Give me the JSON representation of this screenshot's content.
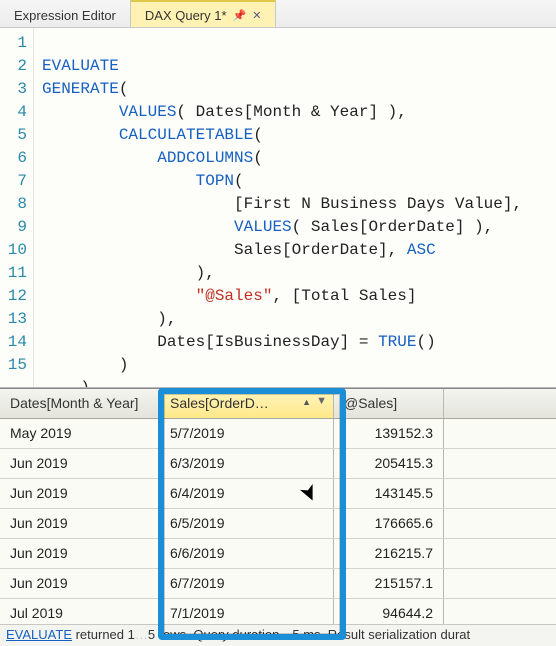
{
  "tabs": {
    "expression": "Expression Editor",
    "query": "DAX Query 1*"
  },
  "code": {
    "lines": 15,
    "l1_kw": "EVALUATE",
    "l2_fn": "GENERATE",
    "l2_r": "(",
    "l3_fn": "VALUES",
    "l3_r": "( Dates[Month & Year] ),",
    "l4_fn": "CALCULATETABLE",
    "l4_r": "(",
    "l5_fn": "ADDCOLUMNS",
    "l5_r": "(",
    "l6_fn": "TOPN",
    "l6_r": "(",
    "l7": "[First N Business Days Value],",
    "l8_fn": "VALUES",
    "l8_r": "( Sales[OrderDate] ),",
    "l9_a": "Sales[OrderDate], ",
    "l9_kw": "ASC",
    "l10": "),",
    "l11_str": "\"@Sales\"",
    "l11_r": ", [Total Sales]",
    "l12": "),",
    "l13_a": "Dates[IsBusinessDay] = ",
    "l13_fn": "TRUE",
    "l13_r": "()",
    "l14": ")",
    "l15": ")"
  },
  "grid": {
    "headers": {
      "c0": "Dates[Month & Year]",
      "c1": "Sales[OrderD…",
      "c2": "@Sales]"
    },
    "rows": [
      {
        "c0": "May 2019",
        "c1": "5/7/2019",
        "c2": "139152.3"
      },
      {
        "c0": "Jun 2019",
        "c1": "6/3/2019",
        "c2": "205415.3"
      },
      {
        "c0": "Jun 2019",
        "c1": "6/4/2019",
        "c2": "143145.5"
      },
      {
        "c0": "Jun 2019",
        "c1": "6/5/2019",
        "c2": "176665.6"
      },
      {
        "c0": "Jun 2019",
        "c1": "6/6/2019",
        "c2": "216215.7"
      },
      {
        "c0": "Jun 2019",
        "c1": "6/7/2019",
        "c2": "215157.1"
      },
      {
        "c0": "Jul 2019",
        "c1": "7/1/2019",
        "c2": "94644.2"
      }
    ]
  },
  "status": {
    "link": "EVALUATE",
    "mid1": " returned 1",
    "mid2": "5 rows. Query duration",
    "mid3": "5 ms. Result serialization durat"
  }
}
